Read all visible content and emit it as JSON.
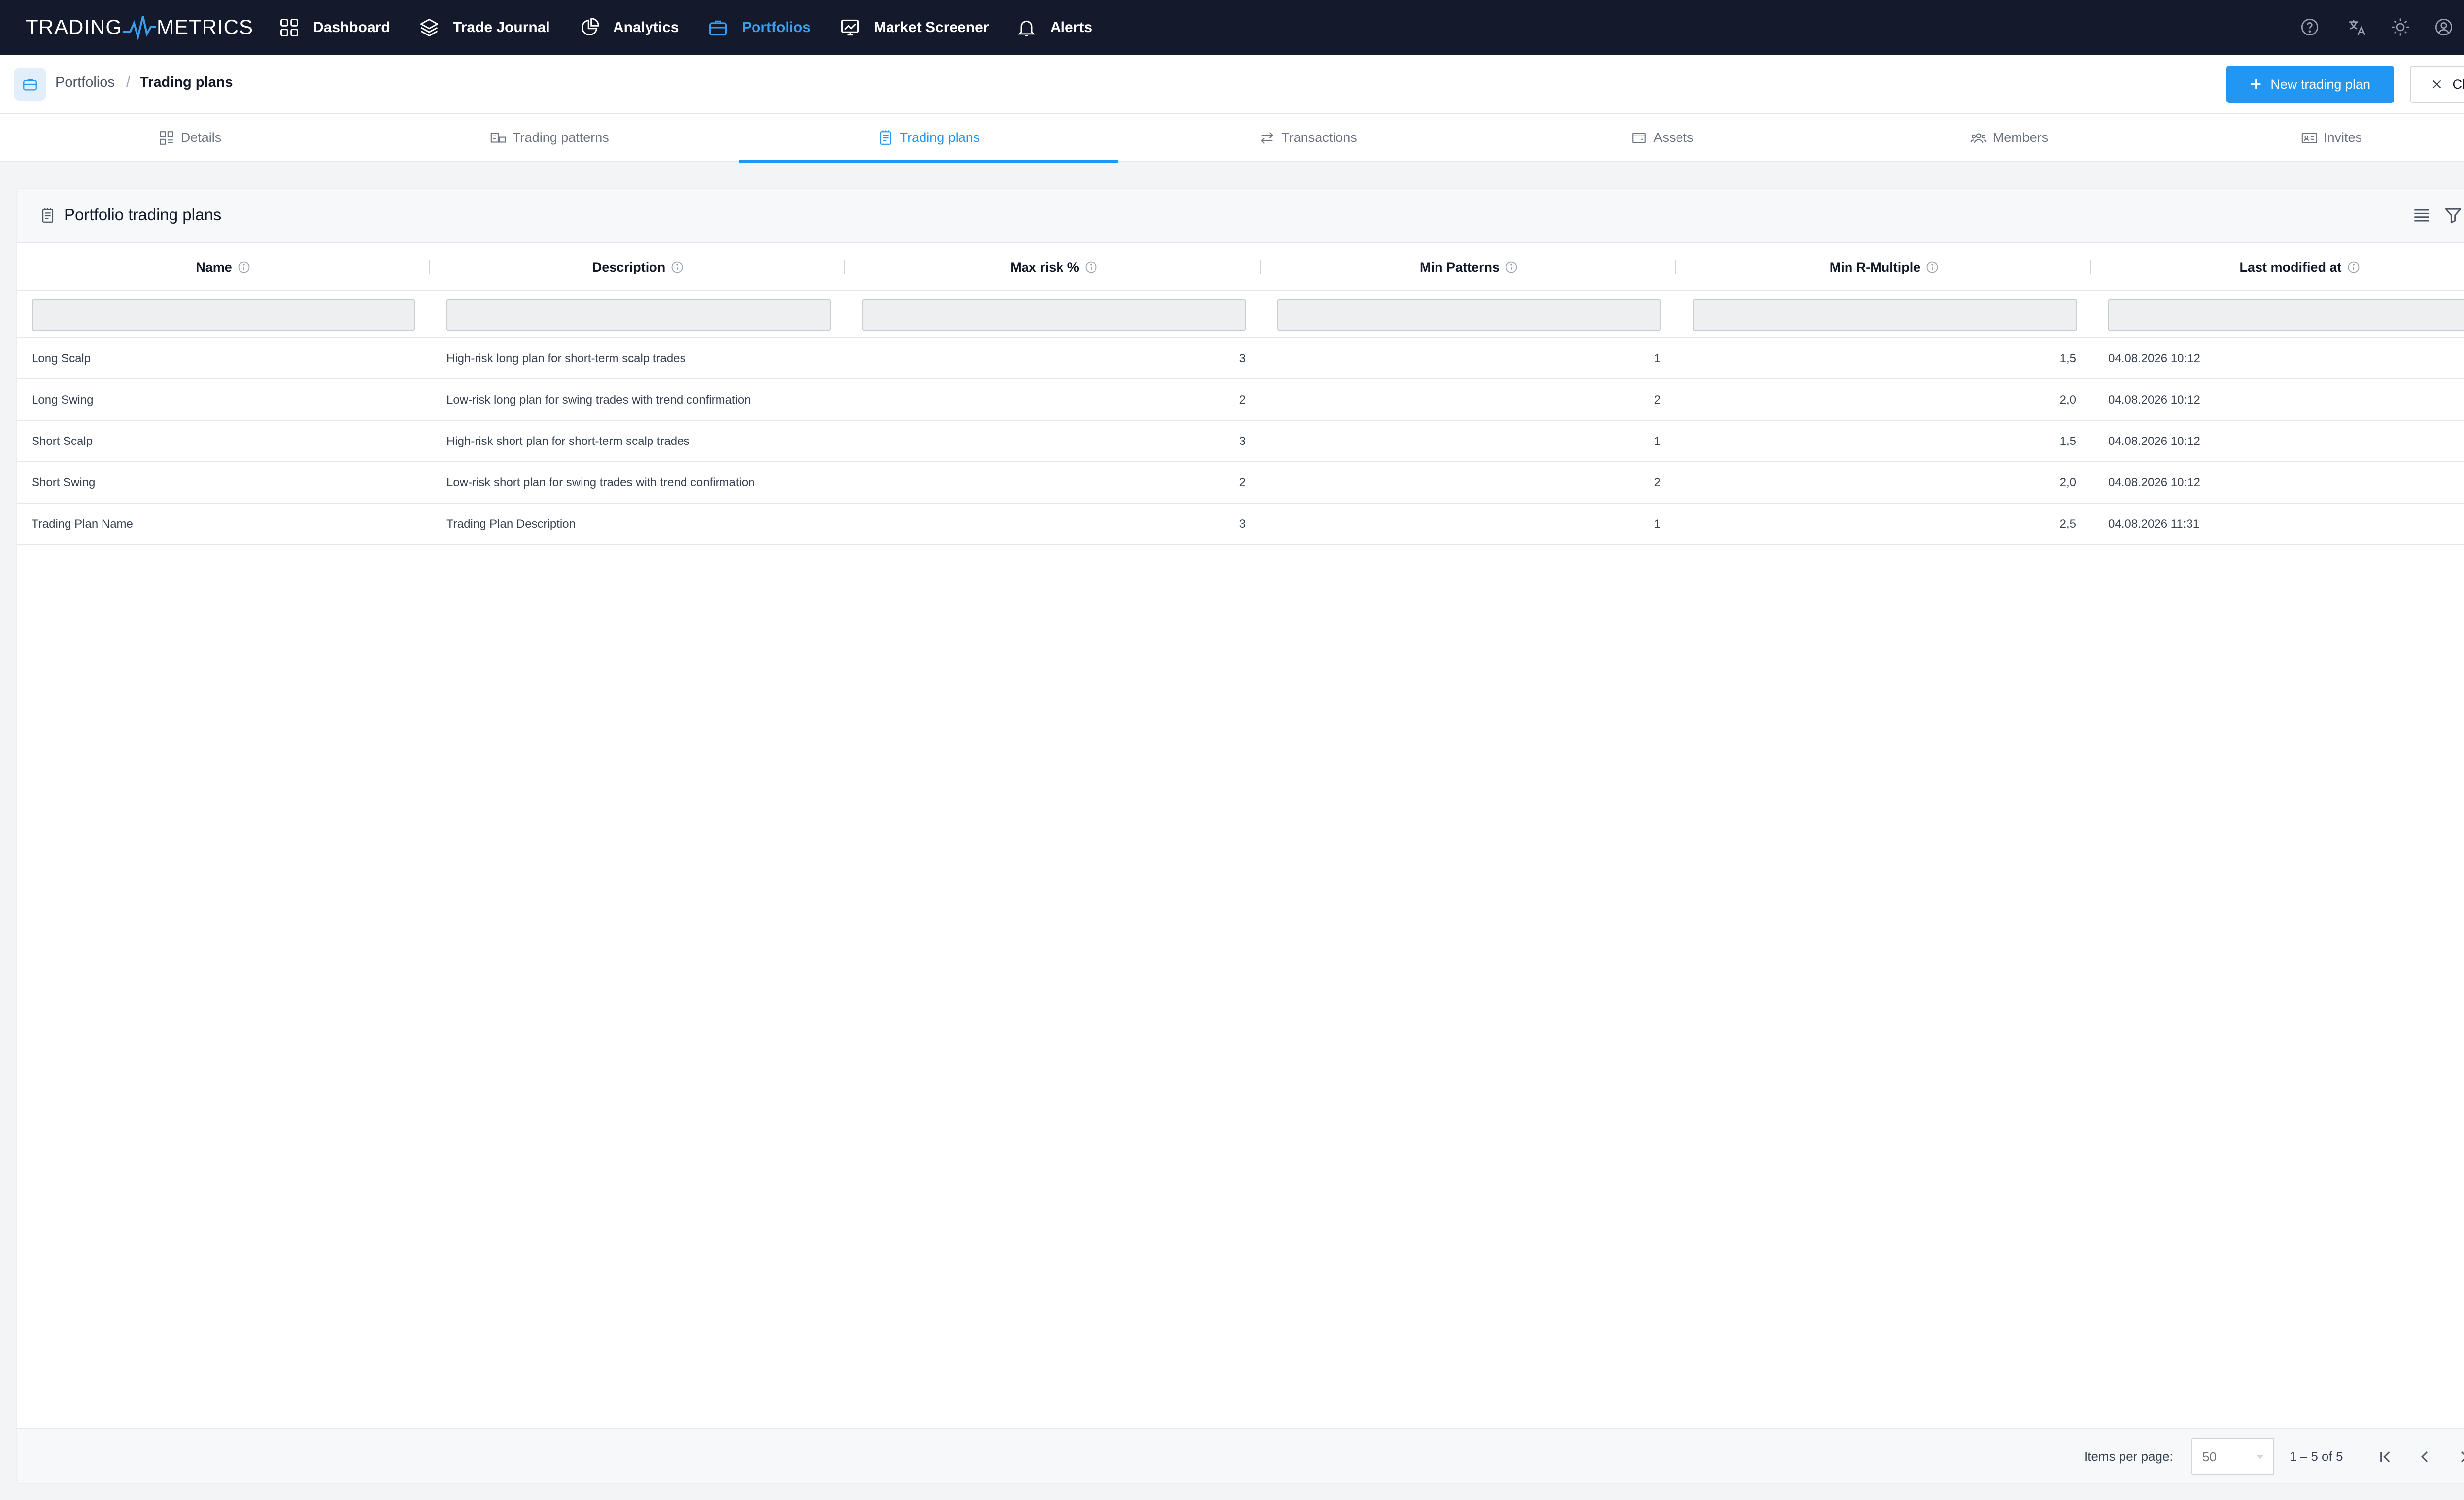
{
  "brand": {
    "left": "TRADING",
    "right": "METRICS"
  },
  "nav": {
    "items": [
      {
        "label": "Dashboard",
        "icon": "grid-icon"
      },
      {
        "label": "Trade Journal",
        "icon": "layers-icon"
      },
      {
        "label": "Analytics",
        "icon": "pie-chart-icon"
      },
      {
        "label": "Portfolios",
        "icon": "briefcase-icon",
        "active": true
      },
      {
        "label": "Market Screener",
        "icon": "monitor-chart-icon"
      },
      {
        "label": "Alerts",
        "icon": "bell-icon"
      }
    ],
    "right_icons": [
      "help-icon",
      "translate-icon",
      "theme-sun-icon",
      "user-account-icon",
      "fullscreen-icon"
    ]
  },
  "breadcrumb": {
    "parent": "Portfolios",
    "separator": "/",
    "current": "Trading plans"
  },
  "actions": {
    "new_label": "New trading plan",
    "close_label": "Close"
  },
  "tabs": [
    {
      "label": "Details",
      "icon": "details-icon"
    },
    {
      "label": "Trading patterns",
      "icon": "patterns-icon"
    },
    {
      "label": "Trading plans",
      "icon": "plans-icon",
      "active": true
    },
    {
      "label": "Transactions",
      "icon": "transfer-icon"
    },
    {
      "label": "Assets",
      "icon": "wallet-icon"
    },
    {
      "label": "Members",
      "icon": "members-icon"
    },
    {
      "label": "Invites",
      "icon": "invite-icon"
    }
  ],
  "card": {
    "title": "Portfolio trading plans",
    "tools": [
      "columns-icon",
      "filter-icon",
      "refresh-icon"
    ]
  },
  "table": {
    "columns": [
      {
        "label": "Name"
      },
      {
        "label": "Description"
      },
      {
        "label": "Max risk %"
      },
      {
        "label": "Min Patterns"
      },
      {
        "label": "Min R-Multiple"
      },
      {
        "label": "Last modified at"
      }
    ],
    "rows": [
      {
        "name": "Long Scalp",
        "description": "High-risk long plan for short-term scalp trades",
        "max_risk": "3",
        "min_patterns": "1",
        "min_r": "1,5",
        "modified": "04.08.2026 10:12"
      },
      {
        "name": "Long Swing",
        "description": "Low-risk long plan for swing trades with trend confirmation",
        "max_risk": "2",
        "min_patterns": "2",
        "min_r": "2,0",
        "modified": "04.08.2026 10:12"
      },
      {
        "name": "Short Scalp",
        "description": "High-risk short plan for short-term scalp trades",
        "max_risk": "3",
        "min_patterns": "1",
        "min_r": "1,5",
        "modified": "04.08.2026 10:12"
      },
      {
        "name": "Short Swing",
        "description": "Low-risk short plan for swing trades with trend confirmation",
        "max_risk": "2",
        "min_patterns": "2",
        "min_r": "2,0",
        "modified": "04.08.2026 10:12"
      },
      {
        "name": "Trading Plan Name",
        "description": "Trading Plan Description",
        "max_risk": "3",
        "min_patterns": "1",
        "min_r": "2,5",
        "modified": "04.08.2026 11:31"
      }
    ]
  },
  "pagination": {
    "items_per_page_label": "Items per page:",
    "items_per_page": "50",
    "range": "1 – 5 of 5"
  },
  "colors": {
    "nav_bg": "#141a2b",
    "accent": "#2196f3"
  }
}
